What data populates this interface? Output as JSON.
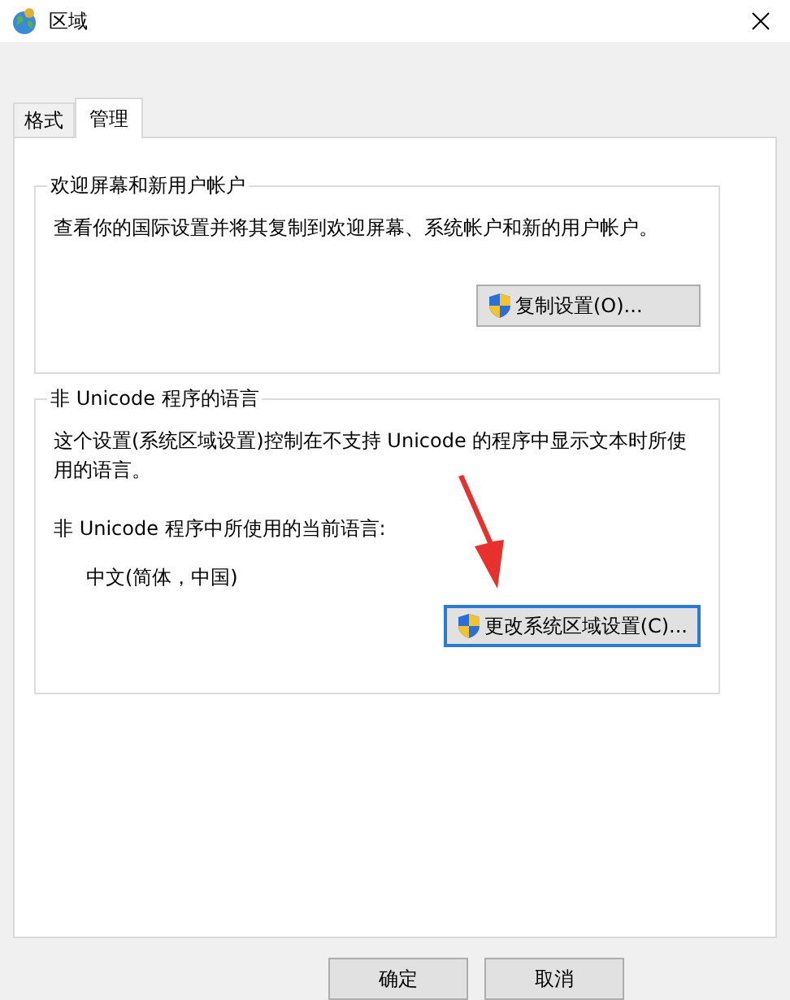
{
  "window": {
    "title": "区域"
  },
  "tabs": [
    {
      "label": "格式",
      "selected": false
    },
    {
      "label": "管理",
      "selected": true
    }
  ],
  "groups": [
    {
      "title": "欢迎屏幕和新用户帐户",
      "lines": [
        {
          "kind": "text",
          "text": "查看你的国际设置并将其复制到欢迎屏幕、系统帐户和新的用户帐户。"
        }
      ],
      "button": {
        "label": "复制设置(O)...",
        "focused": false
      }
    },
    {
      "title": "非 Unicode 程序的语言",
      "lines": [
        {
          "kind": "text",
          "text": "这个设置(系统区域设置)控制在不支持 Unicode 的程序中显示文本时所使用的语言。"
        },
        {
          "kind": "text",
          "text": "非 Unicode 程序中所使用的当前语言:"
        },
        {
          "kind": "value",
          "text": "中文(简体，中国)"
        }
      ],
      "button": {
        "label": "更改系统区域设置(C)...",
        "focused": true
      }
    }
  ],
  "buttons": [
    "确定",
    "取消"
  ]
}
